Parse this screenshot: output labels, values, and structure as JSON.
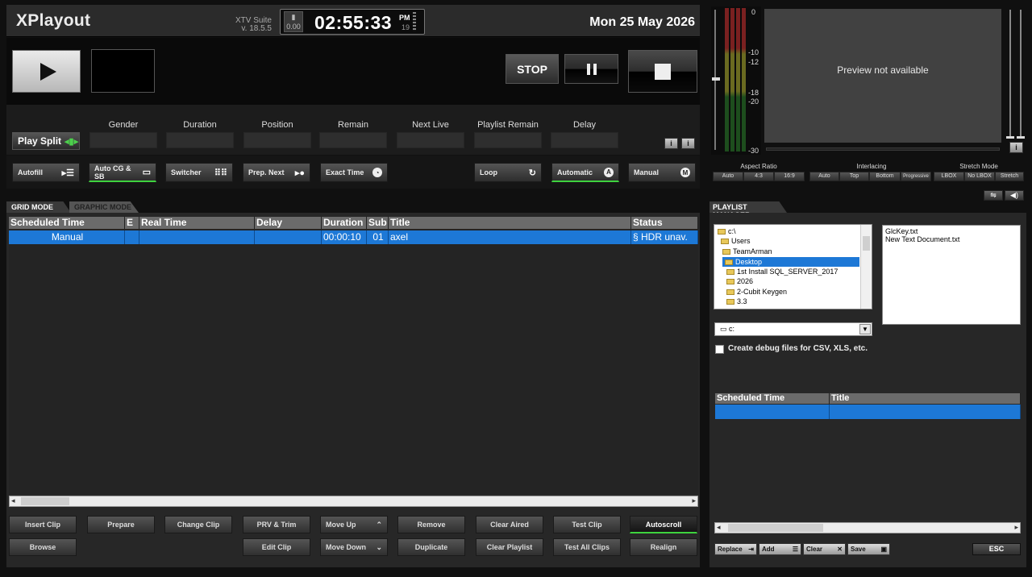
{
  "header": {
    "app_title": "XPlayout",
    "suite_name": "XTV Suite",
    "version": "v. 18.5.5",
    "clock_small_value": "0.00",
    "clock_time": "02:55:33",
    "clock_ampm": "PM",
    "clock_sec": "19",
    "date": "Mon 25 May 2026"
  },
  "transport": {
    "stop_label": "STOP"
  },
  "info": {
    "play_split_label": "Play Split",
    "fields": [
      "Gender",
      "Duration",
      "Position",
      "Remain",
      "Next Live",
      "Playlist Remain",
      "Delay"
    ],
    "info_icon": "i"
  },
  "toolbar": {
    "autofill": "Autofill",
    "auto_cg": "Auto CG & SB",
    "switcher": "Switcher",
    "prep_next": "Prep. Next",
    "exact_time": "Exact Time",
    "loop": "Loop",
    "automatic": "Automatic",
    "automatic_badge": "A",
    "manual": "Manual",
    "manual_badge": "M"
  },
  "grid": {
    "tab_grid": "GRID MODE",
    "tab_graphic": "GRAPHIC MODE",
    "columns": [
      "Scheduled Time",
      "E",
      "Real Time",
      "Delay",
      "Duration",
      "Sub",
      "Title",
      "Status"
    ],
    "rows": [
      {
        "scheduled": "Manual",
        "e": "",
        "real": "",
        "delay": "",
        "duration": "00:00:10",
        "sub": "01",
        "title": "axel",
        "status": "§ HDR unav."
      }
    ]
  },
  "bottom_buttons": {
    "insert_clip": "Insert Clip",
    "prepare": "Prepare",
    "change_clip": "Change Clip",
    "prv_trim": "PRV & Trim",
    "move_up": "Move Up",
    "remove": "Remove",
    "clear_aired": "Clear Aired",
    "test_clip": "Test Clip",
    "autoscroll": "Autoscroll",
    "browse": "Browse",
    "edit_clip": "Edit Clip",
    "move_down": "Move Down",
    "duplicate": "Duplicate",
    "clear_playlist": "Clear Playlist",
    "test_all_clips": "Test All Clips",
    "realign": "Realign"
  },
  "vu": {
    "labels": [
      "0",
      "-10",
      "-12",
      "-18",
      "-20",
      "-30"
    ]
  },
  "preview": {
    "text": "Preview not available"
  },
  "video_settings": {
    "aspect_ratio_label": "Aspect Ratio",
    "aspect_options": [
      "Auto",
      "4:3",
      "16:9"
    ],
    "interlacing_label": "Interlacing",
    "interlacing_options": [
      "Auto",
      "Top",
      "Bottom",
      "Progressive"
    ],
    "stretch_label": "Stretch Mode",
    "stretch_options": [
      "LBOX",
      "No LBOX",
      "Stretch"
    ]
  },
  "playlist_manager": {
    "tab_label": "PLAYLIST MANAGER",
    "tree": [
      "c:\\",
      "Users",
      "TeamArman",
      "Desktop",
      "1st Install SQL_SERVER_2017",
      "2026",
      "2-Cubit Keygen",
      "3.3"
    ],
    "files": [
      "GlcKey.txt",
      "New Text Document.txt"
    ],
    "drive": "c:",
    "debug_label": "Create debug files for CSV, XLS, etc.",
    "columns": [
      "Scheduled Time",
      "Title"
    ],
    "replace": "Replace",
    "add": "Add",
    "clear": "Clear",
    "save": "Save",
    "esc": "ESC"
  }
}
